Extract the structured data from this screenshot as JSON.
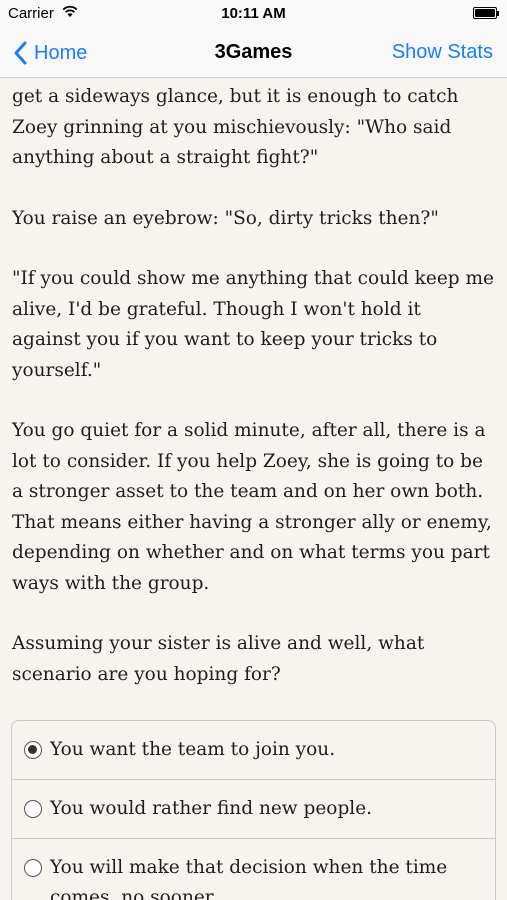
{
  "status_bar": {
    "carrier": "Carrier",
    "time": "10:11 AM"
  },
  "nav": {
    "back_label": "Home",
    "title": "3Games",
    "right_label": "Show Stats"
  },
  "story": {
    "paragraphs": [
      "get a sideways glance, but it is enough to catch Zoey grinning at you mischievously: \"Who said anything about a straight fight?\"",
      "You raise an eyebrow: \"So, dirty tricks then?\"",
      "\"If you could show me anything that could keep me alive, I'd be grateful. Though I won't hold it against you if you want to keep your tricks to yourself.\"",
      "You go quiet for a solid minute, after all, there is a lot to consider. If you help Zoey, she is going to be a stronger asset to the team and on her own both. That means either having a stronger ally or enemy, depending on whether and on what terms you part ways with the group.",
      "Assuming your sister is alive and well, what scenario are you hoping for?"
    ]
  },
  "choices": [
    {
      "label": "You want the team to join you.",
      "selected": true
    },
    {
      "label": "You would rather find new people.",
      "selected": false
    },
    {
      "label": "You will make that decision when the time comes, no sooner.",
      "selected": false
    }
  ]
}
